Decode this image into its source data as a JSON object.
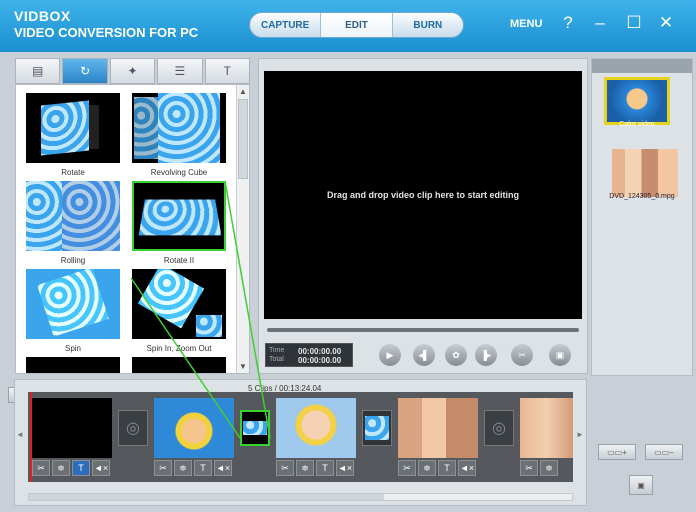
{
  "app": {
    "brand_line1": "VIDBOX",
    "brand_line2": "VIDEO CONVERSION FOR PC",
    "accent": "#1f97dc"
  },
  "modes": [
    {
      "label": "CAPTURE"
    },
    {
      "label": "EDIT"
    },
    {
      "label": "BURN"
    }
  ],
  "window": {
    "menu": "MENU",
    "help": "?",
    "minimize": "–",
    "maximize": "☐",
    "close": "✕"
  },
  "effect_tabs": [
    {
      "icon": "filmstrip-icon",
      "glyph": "▤"
    },
    {
      "icon": "transition-swirl-icon",
      "glyph": "↻"
    },
    {
      "icon": "magic-wand-icon",
      "glyph": "✦"
    },
    {
      "icon": "sliders-icon",
      "glyph": "☰"
    },
    {
      "icon": "text-icon",
      "glyph": "T"
    }
  ],
  "effects": [
    {
      "name": "Rotate"
    },
    {
      "name": "Revolving Cube"
    },
    {
      "name": "Rolling"
    },
    {
      "name": "Rotate II"
    },
    {
      "name": "Spin"
    },
    {
      "name": "Spin In, Zoom Out"
    }
  ],
  "preview": {
    "drop_hint": "Drag and drop video clip here to start editing",
    "time_label": "Time",
    "total_label": "Total",
    "time_value": "00:00:00.00",
    "total_value": "00:00:00.00"
  },
  "player_buttons": [
    {
      "icon": "play-icon",
      "glyph": "▶"
    },
    {
      "icon": "previous-frame-icon",
      "glyph": "◂▌"
    },
    {
      "icon": "settings-icon",
      "glyph": "✿"
    },
    {
      "icon": "next-frame-icon",
      "glyph": "▐▸"
    },
    {
      "icon": "cut-icon",
      "glyph": "✂"
    },
    {
      "icon": "save-icon",
      "glyph": "▣"
    }
  ],
  "media": [
    {
      "caption": "Color video",
      "selected": true
    },
    {
      "caption": "DVD_124305_0.mpg",
      "selected": false
    }
  ],
  "media_buttons": {
    "add": "▭▭+",
    "remove": "▭▭−"
  },
  "timeline": {
    "info": "5 Clips / 00:13:24.04",
    "clip_tool_glyphs": [
      "✂",
      "≑",
      "T",
      "◄×"
    ]
  }
}
